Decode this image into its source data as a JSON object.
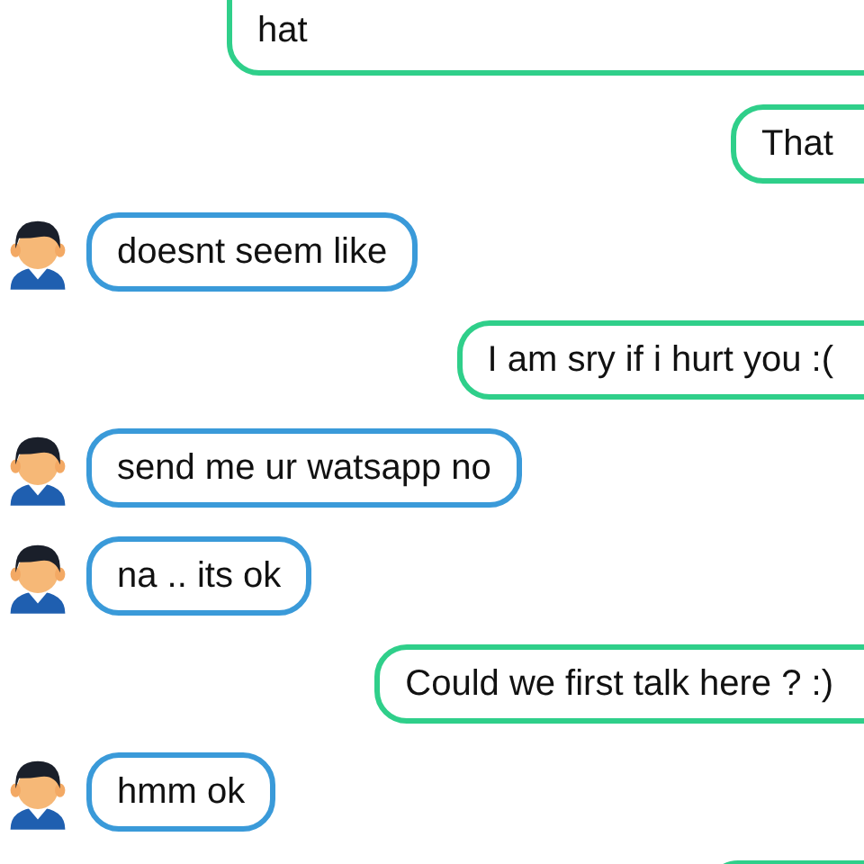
{
  "messages": [
    {
      "kind": "sent",
      "text": "hat"
    },
    {
      "kind": "sent",
      "text": "That"
    },
    {
      "kind": "received",
      "text": "doesnt seem like"
    },
    {
      "kind": "sent",
      "text": "I am sry if i hurt you :("
    },
    {
      "kind": "received",
      "text": "send me ur watsapp no"
    },
    {
      "kind": "received",
      "text": "na .. its ok"
    },
    {
      "kind": "sent",
      "text": "Could we first talk here ? :)"
    },
    {
      "kind": "received",
      "text": "hmm ok"
    },
    {
      "kind": "sent"
    }
  ]
}
